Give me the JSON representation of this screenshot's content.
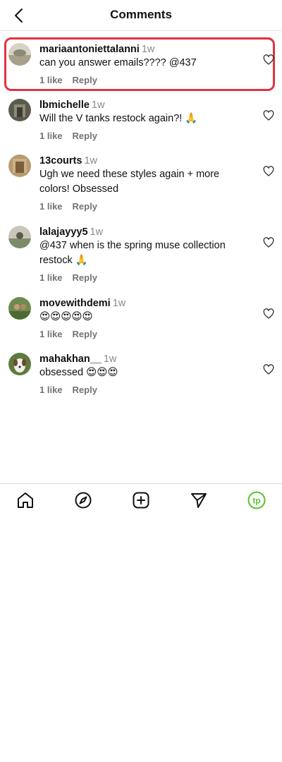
{
  "header": {
    "title": "Comments"
  },
  "comments": [
    {
      "username": "mariaantoniettalanni",
      "time": "1w",
      "text": "can you answer emails???? @437",
      "likes": "1 like",
      "reply": "Reply"
    },
    {
      "username": "lbmichelle",
      "time": "1w",
      "text": "Will the V tanks restock again?! 🙏",
      "likes": "1 like",
      "reply": "Reply"
    },
    {
      "username": "13courts",
      "time": "1w",
      "text": "Ugh we need these styles again + more colors! Obsessed",
      "likes": "1 like",
      "reply": "Reply"
    },
    {
      "username": "lalajayyy5",
      "time": "1w",
      "text": "@437 when is the spring muse collection restock 🙏",
      "likes": "1 like",
      "reply": "Reply"
    },
    {
      "username": "movewithdemi",
      "time": "1w",
      "text": "😍😍😍😍😍",
      "likes": "1 like",
      "reply": "Reply"
    },
    {
      "username": "mahakhan__",
      "time": "1w",
      "text": "obsessed 😍😍😍",
      "likes": "1 like",
      "reply": "Reply"
    }
  ],
  "nav": {
    "icons": [
      "home-icon",
      "explore-icon",
      "create-icon",
      "send-icon",
      "profile-avatar"
    ],
    "profile_label": "tp"
  },
  "colors": {
    "highlight": "#e3323f",
    "profile_accent": "#5cc22c",
    "muted": "#737373"
  }
}
